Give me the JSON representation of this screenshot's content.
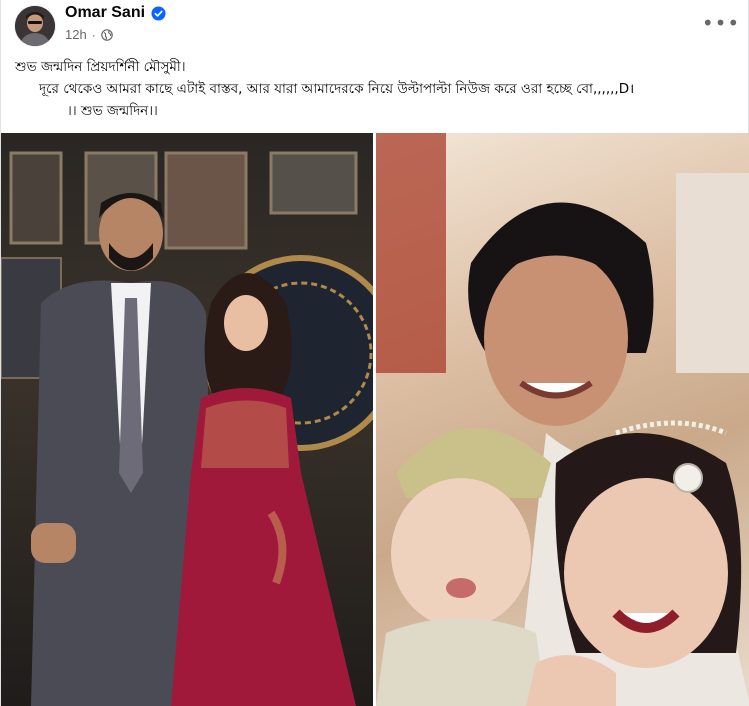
{
  "post": {
    "author": "Omar Sani",
    "time": "12h",
    "separator": "·",
    "more": "•••",
    "text_line1": "শুভ জন্মদিন প্রিয়দর্শিনী মৌসুমী।",
    "text_line2": "দূরে থেকেও আমরা কাছে এটাই বাস্তব, আর যারা আমাদেরকে নিয়ে উল্টাপাল্টা নিউজ করে ওরা হচ্ছে বো,,,,,,D।",
    "text_line3": "।। শুভ জন্মদিন।।"
  },
  "icons": {
    "avatar": "profile-photo",
    "verified": "verified-badge-icon",
    "privacy": "globe-icon",
    "more": "more-options-icon"
  },
  "colors": {
    "verified_blue": "#0866ff",
    "meta_gray": "#65676b",
    "dress_red": "#a0193b"
  }
}
